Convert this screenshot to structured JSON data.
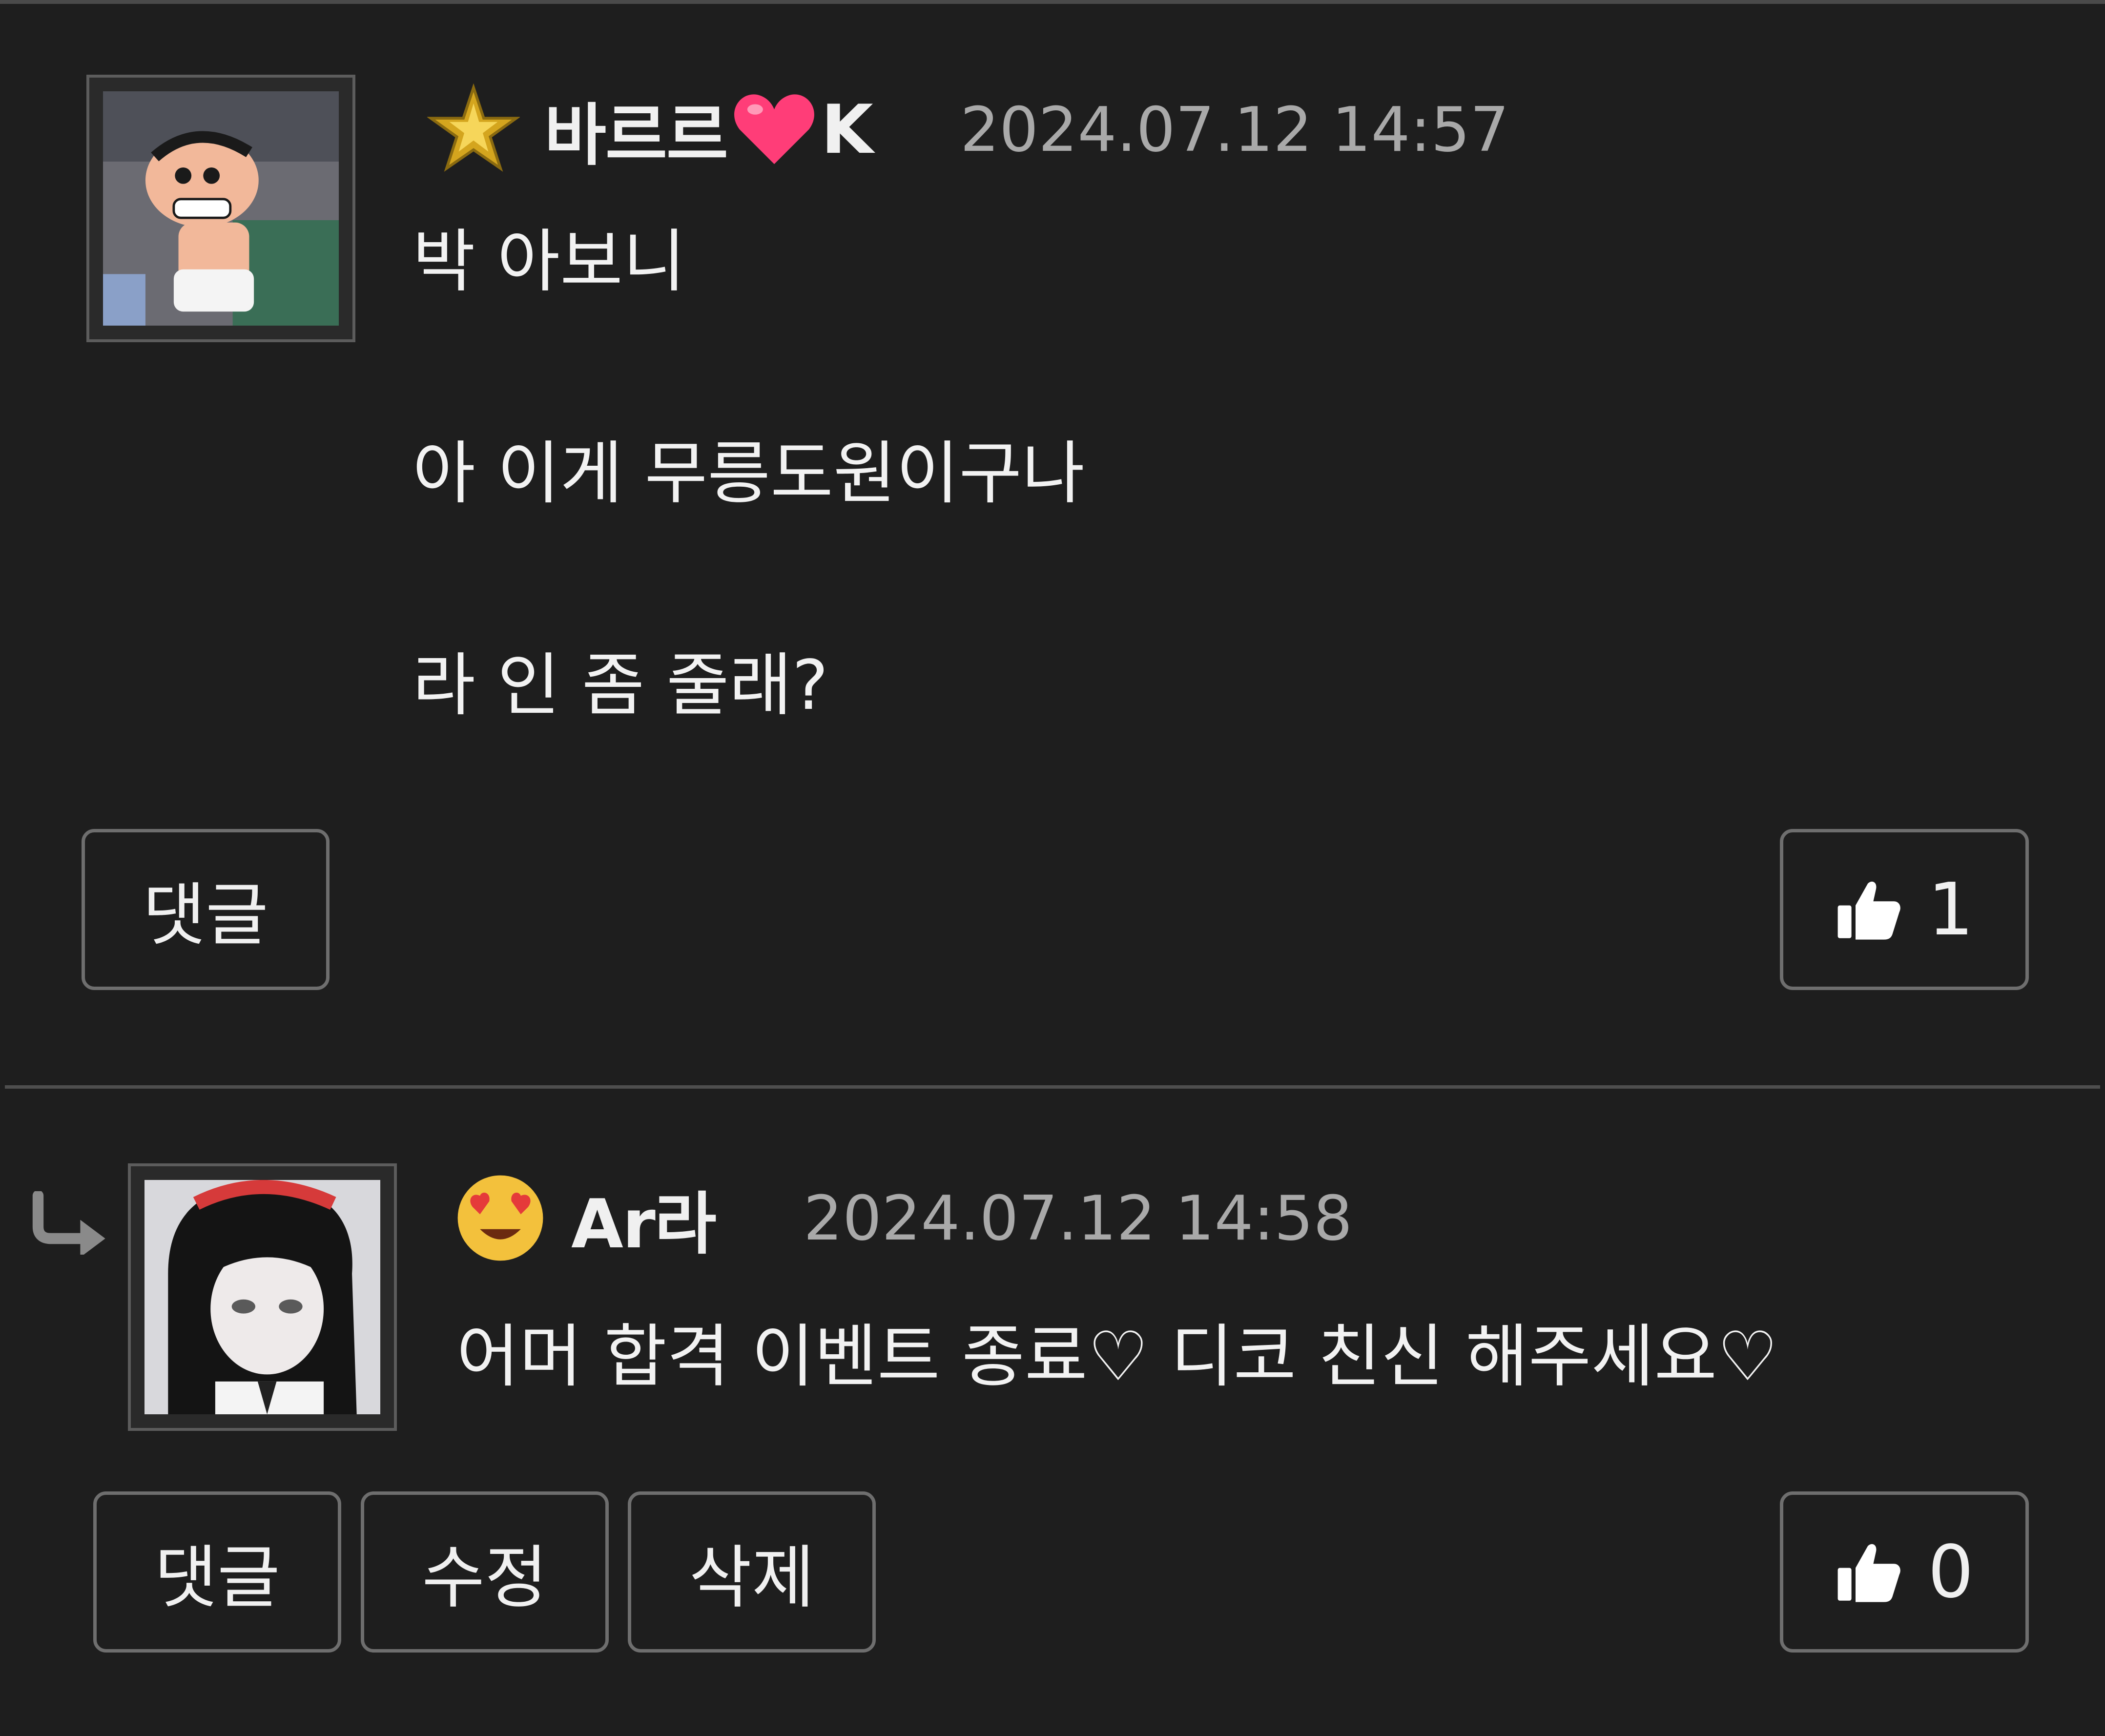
{
  "comments": [
    {
      "nickname_prefix": "바르르",
      "nickname_suffix": "K",
      "timestamp": "2024.07.12 14:57",
      "lines": [
        "박 아보니",
        "아 이게 무릉도원이구나",
        "라 인 좀 줄래?"
      ],
      "reply_label": "댓글",
      "likes": "1",
      "level_icon": "gold-star-badge-icon",
      "heart_icon": "pink-heart-emoji-icon"
    },
    {
      "nickname": "Ar라",
      "timestamp": "2024.07.12 14:58",
      "text": "어머 합격 이벤트 종료♡ 디코 친신 해주세요♡",
      "reply_label": "댓글",
      "edit_label": "수정",
      "delete_label": "삭제",
      "likes": "0",
      "level_icon": "heart-eyes-emoji-icon",
      "reply_icon": "reply-arrow-icon"
    }
  ],
  "colors": {
    "background": "#1e1e1e",
    "border": "#6e6e6e",
    "timestamp": "#a9a9a9",
    "text": "#f2f2f2"
  }
}
